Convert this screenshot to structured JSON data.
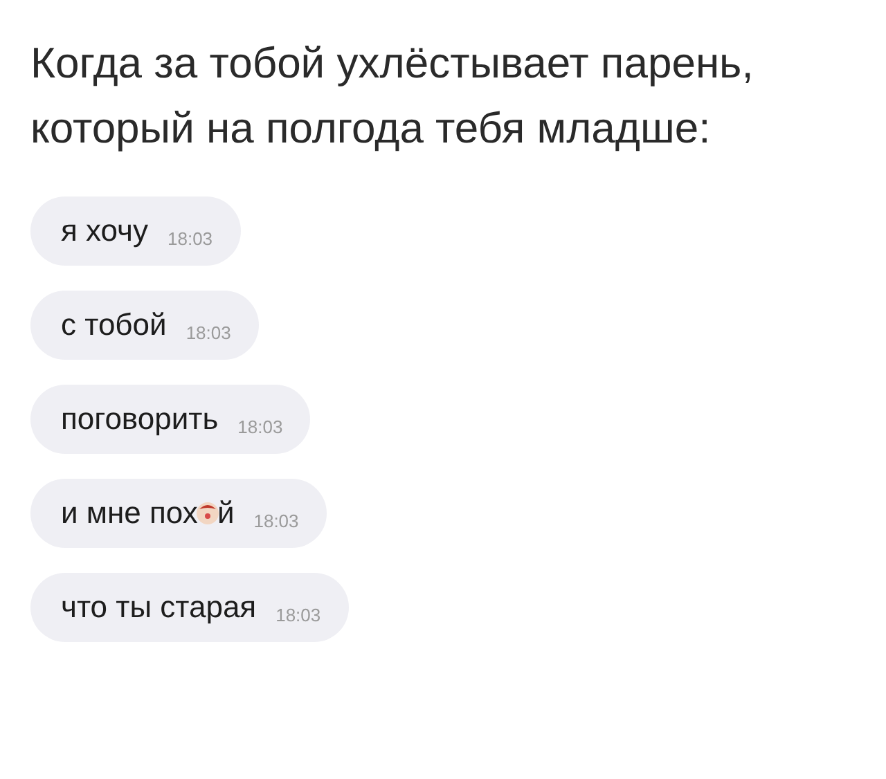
{
  "caption": "Когда за тобой ухлёстывает парень, который на полгода тебя младше:",
  "messages": [
    {
      "text": "я хочу",
      "time": "18:03"
    },
    {
      "text": "с тобой",
      "time": "18:03"
    },
    {
      "text": "поговорить",
      "time": "18:03"
    },
    {
      "text": "и мне пох",
      "emoji": true,
      "text_after": "й",
      "time": "18:03"
    },
    {
      "text": "что ты старая",
      "time": "18:03"
    }
  ]
}
